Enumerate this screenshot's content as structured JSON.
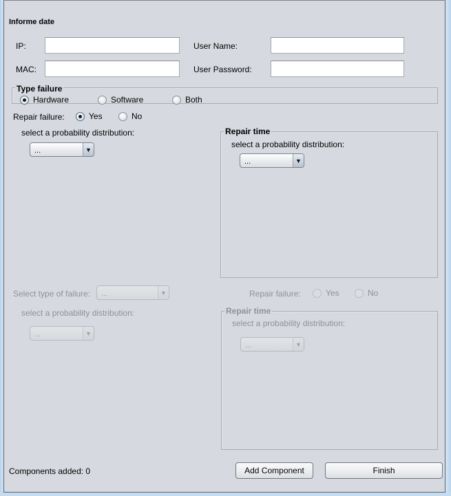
{
  "section_title": "Informe date",
  "fields": {
    "ip": {
      "label": "IP:",
      "value": ""
    },
    "mac": {
      "label": "MAC:",
      "value": ""
    },
    "user_name": {
      "label": "User Name:",
      "value": ""
    },
    "user_password": {
      "label": "User Password:",
      "value": ""
    }
  },
  "type_failure": {
    "title": "Type failure",
    "options": [
      "Hardware",
      "Software",
      "Both"
    ],
    "selected": "Hardware"
  },
  "repair_failure": {
    "label": "Repair failure:",
    "options": [
      "Yes",
      "No"
    ],
    "selected": "Yes"
  },
  "failure_distribution": {
    "label": "select a probability distribution:",
    "selected": "..."
  },
  "repair_time": {
    "title": "Repair time",
    "label": "select a probability distribution:",
    "selected": "..."
  },
  "disabled_section": {
    "type_label": "Select type of failure:",
    "type_selected": "...",
    "distribution_label": "select a probability distribution:",
    "distribution_selected": "...",
    "repair_failure_label": "Repair failure:",
    "repair_options": [
      "Yes",
      "No"
    ],
    "repair_time_title": "Repair time",
    "repair_time_label": "select a probability distribution:",
    "repair_time_selected": "..."
  },
  "footer": {
    "components_added": "Components added: 0",
    "add_component_label": "Add Component",
    "finish_label": "Finish"
  }
}
